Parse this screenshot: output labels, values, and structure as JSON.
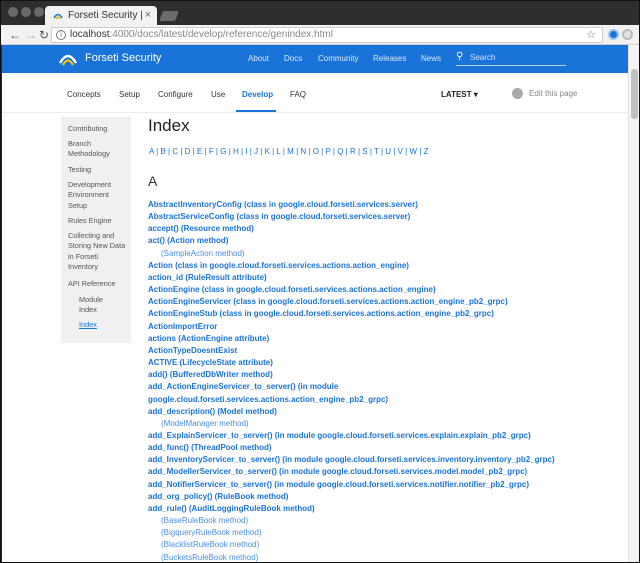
{
  "browser": {
    "tab_title": "Forseti Security | In",
    "tab_close": "×",
    "url_host": "localhost",
    "url_rest": ":4000/docs/latest/develop/reference/genindex.html"
  },
  "site": {
    "brand": "Forseti Security",
    "nav": [
      "About",
      "Docs",
      "Community",
      "Releases",
      "News"
    ],
    "search_placeholder": "Search"
  },
  "subnav": {
    "items": [
      "Concepts",
      "Setup",
      "Configure",
      "Use",
      "Develop",
      "FAQ"
    ],
    "active": "Develop",
    "version": "LATEST ▾",
    "edit": "Edit this page"
  },
  "sidebar": {
    "items": [
      {
        "label": "Contributing"
      },
      {
        "label": "Branch Methodology"
      },
      {
        "label": "Testing"
      },
      {
        "label": "Development Environment Setup"
      },
      {
        "label": "Rules Engine"
      },
      {
        "label": "Collecting and Storing New Data in Forseti Inventory"
      },
      {
        "label": "API Reference"
      },
      {
        "label": "Module Index"
      },
      {
        "label": "Index"
      }
    ]
  },
  "main": {
    "title": "Index",
    "letters": [
      "A",
      "B",
      "C",
      "D",
      "E",
      "F",
      "G",
      "H",
      "I",
      "J",
      "K",
      "L",
      "M",
      "N",
      "O",
      "P",
      "Q",
      "R",
      "S",
      "T",
      "U",
      "V",
      "W",
      "Z"
    ],
    "section": "A",
    "entries": [
      {
        "t": "AbstractInventoryConfig (class in google.cloud.forseti.services.server)"
      },
      {
        "t": "AbstractServiceConfig (class in google.cloud.forseti.services.server)"
      },
      {
        "t": "accept() (Resource method)"
      },
      {
        "t": "act() (Action method)"
      },
      {
        "t": "(SampleAction method)"
      },
      {
        "t": "Action (class in google.cloud.forseti.services.actions.action_engine)"
      },
      {
        "t": "action_id (RuleResult attribute)"
      },
      {
        "t": "ActionEngine (class in google.cloud.forseti.services.actions.action_engine)"
      },
      {
        "t": "ActionEngineServicer (class in google.cloud.forseti.services.actions.action_engine_pb2_grpc)"
      },
      {
        "t": "ActionEngineStub (class in google.cloud.forseti.services.actions.action_engine_pb2_grpc)"
      },
      {
        "t": "ActionImportError"
      },
      {
        "t": "actions (ActionEngine attribute)"
      },
      {
        "t": "ActionTypeDoesntExist"
      },
      {
        "t": "ACTIVE (LifecycleState attribute)"
      },
      {
        "t": "add() (BufferedDbWriter method)"
      },
      {
        "t": "add_ActionEngineServicer_to_server() (in module"
      },
      {
        "t": "google.cloud.forseti.services.actions.action_engine_pb2_grpc)"
      },
      {
        "t": "add_description() (Model method)"
      },
      {
        "t": "(ModelManager method)"
      },
      {
        "t": "add_ExplainServicer_to_server() (in module google.cloud.forseti.services.explain.explain_pb2_grpc)"
      },
      {
        "t": "add_func() (ThreadPool method)"
      },
      {
        "t": "add_InventoryServicer_to_server() (in module google.cloud.forseti.services.inventory.inventory_pb2_grpc)"
      },
      {
        "t": "add_ModellerServicer_to_server() (in module google.cloud.forseti.services.model.model_pb2_grpc)"
      },
      {
        "t": "add_NotifierServicer_to_server() (in module google.cloud.forseti.services.notifier.notifier_pb2_grpc)"
      },
      {
        "t": "add_org_policy() (RuleBook method)"
      },
      {
        "t": "add_rule() (AuditLoggingRuleBook method)"
      },
      {
        "t": "(BaseRuleBook method)"
      },
      {
        "t": "(BigqueryRuleBook method)"
      },
      {
        "t": "(BlacklistRuleBook method)"
      },
      {
        "t": "(BucketsRuleBook method)"
      }
    ]
  },
  "colors": {
    "accent": "#1a73d9",
    "header": "#1a73d9",
    "sidebar_bg": "#f0f0f0"
  }
}
